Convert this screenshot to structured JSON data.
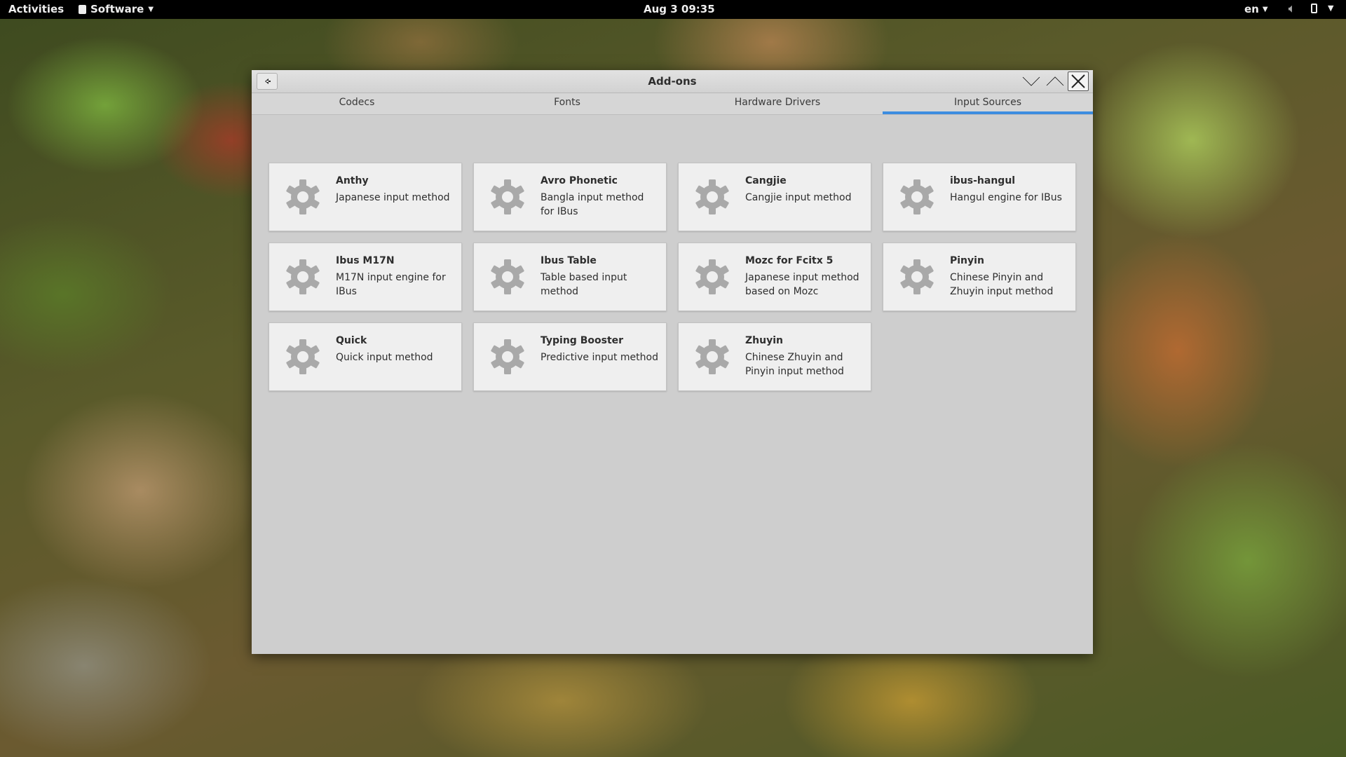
{
  "topbar": {
    "activities": "Activities",
    "app_name": "Software",
    "clock": "Aug 3  09:35",
    "language": "en"
  },
  "window": {
    "title": "Add-ons"
  },
  "tabs": [
    {
      "label": "Codecs",
      "active": false
    },
    {
      "label": "Fonts",
      "active": false
    },
    {
      "label": "Hardware Drivers",
      "active": false
    },
    {
      "label": "Input Sources",
      "active": true
    }
  ],
  "addons": [
    {
      "name": "Anthy",
      "description": "Japanese input method",
      "icon": "gear-icon"
    },
    {
      "name": "Avro Phonetic",
      "description": "Bangla input method for IBus",
      "icon": "gear-icon"
    },
    {
      "name": "Cangjie",
      "description": "Cangjie input method",
      "icon": "gear-icon"
    },
    {
      "name": "ibus-hangul",
      "description": "Hangul engine for IBus",
      "icon": "gear-icon"
    },
    {
      "name": "Ibus M17N",
      "description": "M17N input engine for IBus",
      "icon": "gear-icon"
    },
    {
      "name": "Ibus Table",
      "description": "Table based input method",
      "icon": "gear-icon"
    },
    {
      "name": "Mozc for Fcitx 5",
      "description": "Japanese input method based on Mozc",
      "icon": "gear-icon"
    },
    {
      "name": "Pinyin",
      "description": "Chinese Pinyin and Zhuyin input method",
      "icon": "gear-icon"
    },
    {
      "name": "Quick",
      "description": "Quick input method",
      "icon": "gear-icon"
    },
    {
      "name": "Typing Booster",
      "description": "Predictive input method",
      "icon": "gear-icon"
    },
    {
      "name": "Zhuyin",
      "description": "Chinese Zhuyin and Pinyin input method",
      "icon": "gear-icon"
    }
  ],
  "colors": {
    "accent": "#3d8de0",
    "window_bg": "#cecece",
    "card_bg": "#efefef",
    "gear": "#a9a9a9"
  }
}
